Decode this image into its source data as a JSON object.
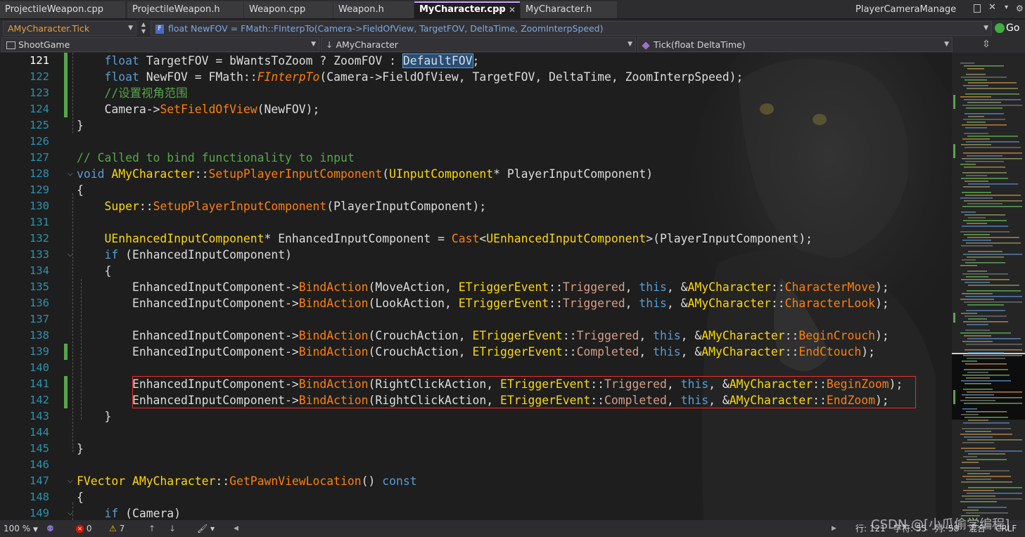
{
  "tabs": [
    {
      "label": "ProjectileWeapon.cpp"
    },
    {
      "label": "ProjectileWeapon.h"
    },
    {
      "label": "Weapon.cpp"
    },
    {
      "label": "Weapon.h"
    },
    {
      "label": "MyCharacter.cpp",
      "active": true
    },
    {
      "label": "MyCharacter.h"
    },
    {
      "label": "PlayerCameraManager.h"
    }
  ],
  "tab_glyphs": {
    "pin": "⊸",
    "close": "✕"
  },
  "navigation": {
    "scope": "AMyCharacter.Tick",
    "statement_icon": "F",
    "statement": "float NewFOV = FMath::FInterpTo(Camera->FieldOfView, TargetFOV, DeltaTime, ZoomInterpSpeed)",
    "go_label": "Go",
    "project": "ShootGame",
    "class_name": "AMyCharacter",
    "member": "Tick(float DeltaTime)"
  },
  "lines": [
    {
      "n": 121,
      "current": true,
      "indent": 1,
      "tokens": [
        [
          "kw",
          "float"
        ],
        [
          "",
          "TargetFOV = bWantsToZoom ? ZoomFOV : "
        ],
        [
          "sel",
          "DefaultFOV"
        ],
        [
          "",
          ";"
        ]
      ]
    },
    {
      "n": 122,
      "indent": 1,
      "tokens": [
        [
          "kw",
          "float"
        ],
        [
          "",
          "NewFOV = FMath::"
        ],
        [
          "fnt",
          "FInterpTo"
        ],
        [
          "",
          "(Camera->FieldOfView, TargetFOV, DeltaTime, ZoomInterpSpeed);"
        ]
      ]
    },
    {
      "n": 123,
      "indent": 1,
      "tokens": [
        [
          "cm",
          "//设置视角范围"
        ]
      ]
    },
    {
      "n": 124,
      "indent": 1,
      "tokens": [
        [
          "",
          "Camera->"
        ],
        [
          "fn",
          "SetFieldOfView"
        ],
        [
          "",
          "(NewFOV);"
        ]
      ]
    },
    {
      "n": 125,
      "indent": 0,
      "tokens": [
        [
          "",
          "}"
        ]
      ]
    },
    {
      "n": 126,
      "indent": 0,
      "tokens": []
    },
    {
      "n": 127,
      "indent": 0,
      "tokens": [
        [
          "cm",
          "// Called to bind functionality to input"
        ]
      ]
    },
    {
      "n": 128,
      "indent": 0,
      "tokens": [
        [
          "kw",
          "void "
        ],
        [
          "yl",
          "AMyCharacter"
        ],
        [
          "",
          "::"
        ],
        [
          "fn",
          "SetupPlayerInputComponent"
        ],
        [
          "",
          "("
        ],
        [
          "yl",
          "UInputComponent"
        ],
        [
          "",
          "* PlayerInputComponent)"
        ]
      ]
    },
    {
      "n": 129,
      "indent": 0,
      "tokens": [
        [
          "",
          "{"
        ]
      ]
    },
    {
      "n": 130,
      "indent": 1,
      "tokens": [
        [
          "yl",
          "Super"
        ],
        [
          "",
          "::"
        ],
        [
          "fn",
          "SetupPlayerInputComponent"
        ],
        [
          "",
          "(PlayerInputComponent);"
        ]
      ]
    },
    {
      "n": 131,
      "indent": 0,
      "tokens": []
    },
    {
      "n": 132,
      "indent": 1,
      "tokens": [
        [
          "yl",
          "UEnhancedInputComponent"
        ],
        [
          "",
          "* EnhancedInputComponent = "
        ],
        [
          "fn",
          "Cast"
        ],
        [
          "",
          "<"
        ],
        [
          "yl",
          "UEnhancedInputComponent"
        ],
        [
          "",
          ">(PlayerInputComponent);"
        ]
      ]
    },
    {
      "n": 133,
      "indent": 1,
      "tokens": [
        [
          "kw",
          "if"
        ],
        [
          "",
          " (EnhancedInputComponent)"
        ]
      ]
    },
    {
      "n": 134,
      "indent": 1,
      "tokens": [
        [
          "",
          "{"
        ]
      ]
    },
    {
      "n": 135,
      "indent": 2,
      "tokens": [
        [
          "",
          "EnhancedInputComponent->"
        ],
        [
          "fn",
          "BindAction"
        ],
        [
          "",
          "(MoveAction, "
        ],
        [
          "yl",
          "ETriggerEvent"
        ],
        [
          "",
          "::"
        ],
        [
          "en",
          "Triggered"
        ],
        [
          "",
          ", "
        ],
        [
          "kw",
          "this"
        ],
        [
          "",
          ", &"
        ],
        [
          "yl",
          "AMyCharacter"
        ],
        [
          "",
          "::"
        ],
        [
          "fn",
          "CharacterMove"
        ],
        [
          "",
          ");"
        ]
      ]
    },
    {
      "n": 136,
      "indent": 2,
      "tokens": [
        [
          "",
          "EnhancedInputComponent->"
        ],
        [
          "fn",
          "BindAction"
        ],
        [
          "",
          "(LookAction, "
        ],
        [
          "yl",
          "ETriggerEvent"
        ],
        [
          "",
          "::"
        ],
        [
          "en",
          "Triggered"
        ],
        [
          "",
          ", "
        ],
        [
          "kw",
          "this"
        ],
        [
          "",
          ", &"
        ],
        [
          "yl",
          "AMyCharacter"
        ],
        [
          "",
          "::"
        ],
        [
          "fn",
          "CharacterLook"
        ],
        [
          "",
          ");"
        ]
      ]
    },
    {
      "n": 137,
      "indent": 0,
      "tokens": []
    },
    {
      "n": 138,
      "indent": 2,
      "tokens": [
        [
          "",
          "EnhancedInputComponent->"
        ],
        [
          "fn",
          "BindAction"
        ],
        [
          "",
          "(CrouchAction, "
        ],
        [
          "yl",
          "ETriggerEvent"
        ],
        [
          "",
          "::"
        ],
        [
          "en",
          "Triggered"
        ],
        [
          "",
          ", "
        ],
        [
          "kw",
          "this"
        ],
        [
          "",
          ", &"
        ],
        [
          "yl",
          "AMyCharacter"
        ],
        [
          "",
          "::"
        ],
        [
          "fn",
          "BeginCrouch"
        ],
        [
          "",
          ");"
        ]
      ]
    },
    {
      "n": 139,
      "indent": 2,
      "tokens": [
        [
          "",
          "EnhancedInputComponent->"
        ],
        [
          "fn",
          "BindAction"
        ],
        [
          "",
          "(CrouchAction, "
        ],
        [
          "yl",
          "ETriggerEvent"
        ],
        [
          "",
          "::"
        ],
        [
          "en",
          "Completed"
        ],
        [
          "",
          ", "
        ],
        [
          "kw",
          "this"
        ],
        [
          "",
          ", &"
        ],
        [
          "yl",
          "AMyCharacter"
        ],
        [
          "",
          "::"
        ],
        [
          "fn",
          "EndCtouch"
        ],
        [
          "",
          ");"
        ]
      ]
    },
    {
      "n": 140,
      "indent": 0,
      "tokens": []
    },
    {
      "n": 141,
      "indent": 2,
      "tokens": [
        [
          "",
          "EnhancedInputComponent->"
        ],
        [
          "fn",
          "BindAction"
        ],
        [
          "",
          "(RightClickAction, "
        ],
        [
          "yl",
          "ETriggerEvent"
        ],
        [
          "",
          "::"
        ],
        [
          "en",
          "Triggered"
        ],
        [
          "",
          ", "
        ],
        [
          "kw",
          "this"
        ],
        [
          "",
          ", &"
        ],
        [
          "yl",
          "AMyCharacter"
        ],
        [
          "",
          "::"
        ],
        [
          "fn",
          "BeginZoom"
        ],
        [
          "",
          ");"
        ]
      ]
    },
    {
      "n": 142,
      "indent": 2,
      "tokens": [
        [
          "",
          "EnhancedInputComponent->"
        ],
        [
          "fn",
          "BindAction"
        ],
        [
          "",
          "(RightClickAction, "
        ],
        [
          "yl",
          "ETriggerEvent"
        ],
        [
          "",
          "::"
        ],
        [
          "en",
          "Completed"
        ],
        [
          "",
          ", "
        ],
        [
          "kw",
          "this"
        ],
        [
          "",
          ", &"
        ],
        [
          "yl",
          "AMyCharacter"
        ],
        [
          "",
          "::"
        ],
        [
          "fn",
          "EndZoom"
        ],
        [
          "",
          ");"
        ]
      ]
    },
    {
      "n": 143,
      "indent": 1,
      "tokens": [
        [
          "",
          "}"
        ]
      ]
    },
    {
      "n": 144,
      "indent": 0,
      "tokens": []
    },
    {
      "n": 145,
      "indent": 0,
      "tokens": [
        [
          "",
          "}"
        ]
      ]
    },
    {
      "n": 146,
      "indent": 0,
      "tokens": []
    },
    {
      "n": 147,
      "indent": 0,
      "tokens": [
        [
          "yl",
          "FVector "
        ],
        [
          "yl",
          "AMyCharacter"
        ],
        [
          "",
          "::"
        ],
        [
          "fn",
          "GetPawnViewLocation"
        ],
        [
          "",
          "() "
        ],
        [
          "kw",
          "const"
        ]
      ]
    },
    {
      "n": 148,
      "indent": 0,
      "tokens": [
        [
          "",
          "{"
        ]
      ]
    },
    {
      "n": 149,
      "indent": 1,
      "tokens": [
        [
          "kw",
          "if"
        ],
        [
          "",
          " (Camera)"
        ]
      ]
    }
  ],
  "status": {
    "zoom": "100 %",
    "errors": "0",
    "warnings": "7",
    "line": "行: 121",
    "char": "字符: 55",
    "col": "列: 58",
    "mixed": "混合",
    "eol": "CRLF"
  },
  "watermark": "CSDN @[小瓜偷学编程]",
  "colors": {
    "accent": "#c8a0ff",
    "highlight_box": "#e5302b",
    "change_bar": "#57a64a"
  }
}
